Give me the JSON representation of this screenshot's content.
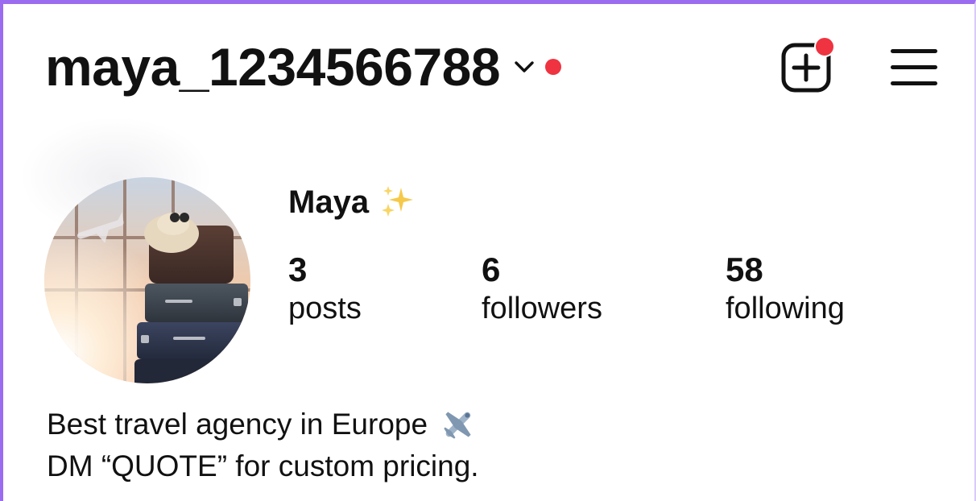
{
  "header": {
    "username": "maya_1234566788",
    "account_switcher_icon": "chevron-down-icon",
    "status_dot_color": "#ef3340",
    "create_icon": "plus-square-icon",
    "menu_icon": "hamburger-menu-icon"
  },
  "profile": {
    "display_name": "Maya",
    "name_emoji": "sparkles-icon",
    "avatar_description_icon": "avatar-photo",
    "stats": [
      {
        "value": "3",
        "label": "posts"
      },
      {
        "value": "6",
        "label": "followers"
      },
      {
        "value": "58",
        "label": "following"
      }
    ],
    "bio": {
      "line1": "Best travel agency in Europe",
      "line1_emoji": "airplane-icon",
      "line2": "DM “QUOTE” for custom pricing."
    }
  },
  "colors": {
    "accent_border": "#9b6cf0",
    "notification": "#ef3340",
    "text": "#111111"
  }
}
